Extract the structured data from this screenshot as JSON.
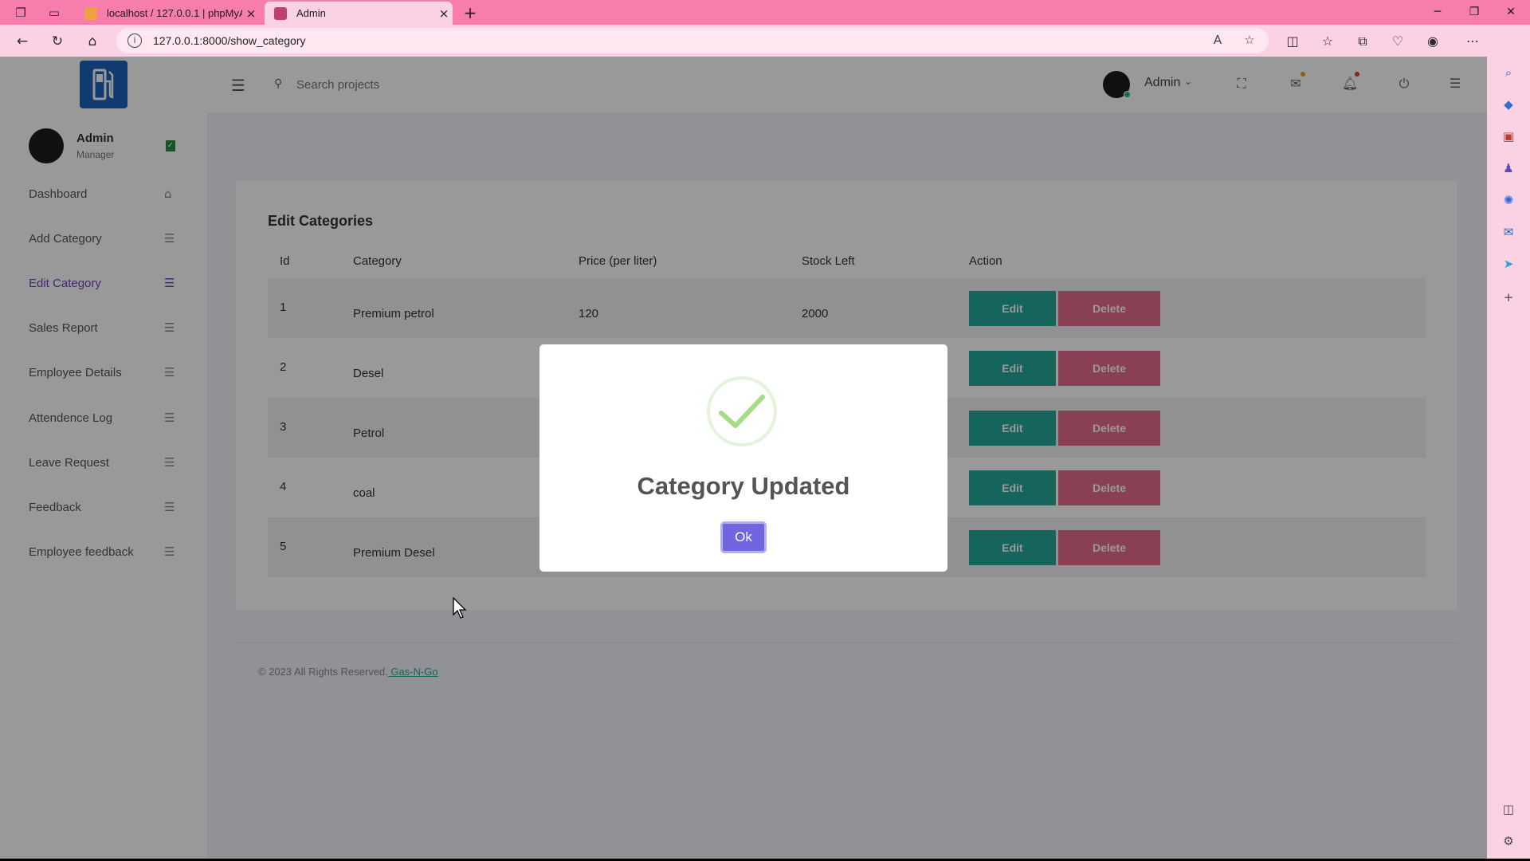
{
  "browser": {
    "tabs": [
      {
        "label": "localhost / 127.0.0.1 | phpMyAdmin"
      },
      {
        "label": "Admin"
      }
    ],
    "url": "127.0.0.1:8000/show_category"
  },
  "header": {
    "search_placeholder": "Search projects",
    "user": "Admin"
  },
  "profile": {
    "name": "Admin",
    "role": "Manager"
  },
  "sidebar": {
    "items": [
      {
        "label": "Dashboard",
        "icon": "home-icon"
      },
      {
        "label": "Add Category",
        "icon": "list-icon"
      },
      {
        "label": "Edit Category",
        "icon": "list-icon",
        "active": true
      },
      {
        "label": "Sales Report",
        "icon": "list-icon"
      },
      {
        "label": "Employee Details",
        "icon": "list-icon"
      },
      {
        "label": "Attendence Log",
        "icon": "list-icon"
      },
      {
        "label": "Leave Request",
        "icon": "list-icon"
      },
      {
        "label": "Feedback",
        "icon": "list-icon"
      },
      {
        "label": "Employee feedback",
        "icon": "list-icon"
      }
    ]
  },
  "main": {
    "title": "Edit Categories",
    "columns": [
      "Id",
      "Category",
      "Price (per liter)",
      "Stock Left",
      "Action"
    ],
    "rows": [
      {
        "id": "1",
        "category": "Premium petrol",
        "price": "120",
        "stock": "2000"
      },
      {
        "id": "2",
        "category": "Desel",
        "price": "",
        "stock": ""
      },
      {
        "id": "3",
        "category": "Petrol",
        "price": "",
        "stock": ""
      },
      {
        "id": "4",
        "category": "coal",
        "price": "",
        "stock": ""
      },
      {
        "id": "5",
        "category": "Premium Desel",
        "price": "",
        "stock": ""
      }
    ],
    "edit_label": "Edit",
    "delete_label": "Delete"
  },
  "footer": {
    "text": "© 2023 All Rights Reserved.",
    "link": " Gas-N-Go"
  },
  "modal": {
    "title": "Category Updated",
    "ok_label": "Ok"
  },
  "colors": {
    "browser_accent": "#f77dac",
    "primary": "#6f42c1",
    "edit": "#24a99a",
    "delete": "#e46b8d",
    "confirm": "#7066e0"
  }
}
